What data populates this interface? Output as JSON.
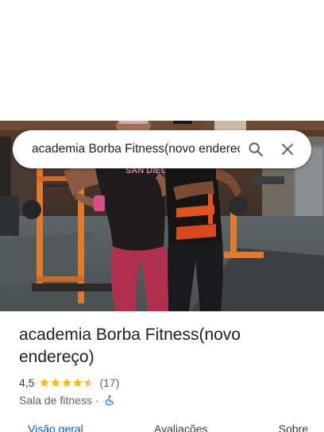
{
  "search": {
    "value": "academia Borba Fitness(novo endereço)",
    "search_icon": "search-icon",
    "close_icon": "close-icon"
  },
  "photo": {
    "shirt_text": "SAN DIEGO"
  },
  "place": {
    "title": "academia Borba Fitness(novo endereço)",
    "rating": "4,5",
    "rating_value": 4.5,
    "stars_total": 5,
    "review_count": "(17)",
    "category": "Sala de fitness",
    "separator": "·",
    "accessibility_icon": "wheelchair-icon"
  },
  "tabs": [
    {
      "label": "Visão geral",
      "active": true
    },
    {
      "label": "Avaliações",
      "active": false
    },
    {
      "label": "Sobre",
      "active": false
    }
  ],
  "colors": {
    "star": "#fbbc04",
    "active_tab": "#0b57d0",
    "access_icon": "#1a73e8"
  }
}
